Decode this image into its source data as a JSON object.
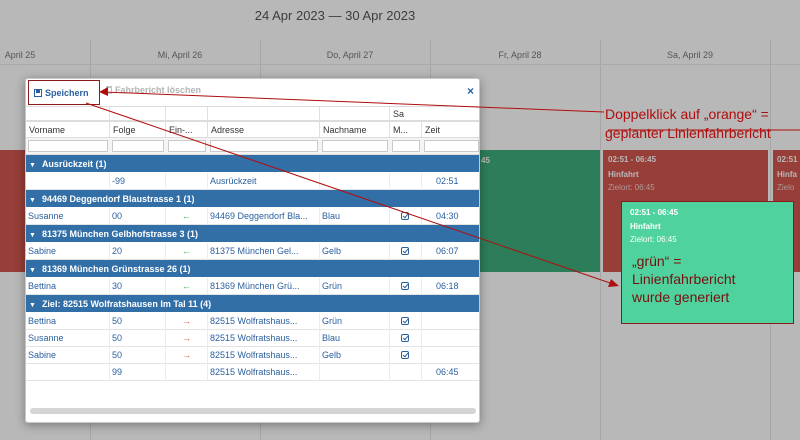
{
  "calendar": {
    "range": "24 Apr 2023 — 30 Apr 2023",
    "days": [
      "April 25",
      "Mi, April 26",
      "Do, April 27",
      "Fr, April 28",
      "Sa, April 29"
    ],
    "event_left": {
      "time": "02:51 - 06:45",
      "title": "Hinfahrt",
      "dest": "Zielort: 06:45"
    },
    "event_right": {
      "time": "02:51",
      "title": "Hinfa",
      "dest": "Zielo"
    },
    "event_green_time": "45",
    "colors": {
      "green": "#3fae7e",
      "orange": "#d0574d",
      "new_green": "#4fd29d"
    }
  },
  "dialog": {
    "save_label": "Speichern",
    "delete_label": "Fahrbericht löschen",
    "close_label": "×",
    "columns": [
      "Vorname",
      "Folge",
      "Ein-...",
      "Adresse",
      "Nachname",
      "M...",
      "Zeit"
    ],
    "column_group": "Sa",
    "groups": [
      {
        "title": "Ausrückzeit (1)",
        "rows": [
          {
            "vorname": "",
            "folge": "-99",
            "dir": "",
            "adresse": "Ausrückzeit",
            "nachname": "",
            "check": false,
            "zeit": "02:51"
          }
        ]
      },
      {
        "title": "94469 Deggendorf Blaustrasse 1 (1)",
        "rows": [
          {
            "vorname": "Susanne",
            "folge": "00",
            "dir": "in",
            "adresse": "94469 Deggendorf Bla...",
            "nachname": "Blau",
            "check": true,
            "zeit": "04:30"
          }
        ]
      },
      {
        "title": "81375 München Gelbhofstrasse 3 (1)",
        "rows": [
          {
            "vorname": "Sabine",
            "folge": "20",
            "dir": "in",
            "adresse": "81375 München Gel...",
            "nachname": "Gelb",
            "check": true,
            "zeit": "06:07"
          }
        ]
      },
      {
        "title": "81369 München Grünstrasse 26 (1)",
        "rows": [
          {
            "vorname": "Bettina",
            "folge": "30",
            "dir": "in",
            "adresse": "81369 München Grü...",
            "nachname": "Grün",
            "check": true,
            "zeit": "06:18"
          }
        ]
      },
      {
        "title": "Ziel: 82515 Wolfratshausen Im Tal 11 (4)",
        "rows": [
          {
            "vorname": "Bettina",
            "folge": "50",
            "dir": "out",
            "adresse": "82515 Wolfratshaus...",
            "nachname": "Grün",
            "check": true,
            "zeit": ""
          },
          {
            "vorname": "Susanne",
            "folge": "50",
            "dir": "out",
            "adresse": "82515 Wolfratshaus...",
            "nachname": "Blau",
            "check": true,
            "zeit": ""
          },
          {
            "vorname": "Sabine",
            "folge": "50",
            "dir": "out",
            "adresse": "82515 Wolfratshaus...",
            "nachname": "Gelb",
            "check": true,
            "zeit": ""
          },
          {
            "vorname": "",
            "folge": "99",
            "dir": "",
            "adresse": "82515 Wolfratshaus...",
            "nachname": "",
            "check": false,
            "zeit": "06:45"
          }
        ]
      }
    ]
  },
  "annotation": {
    "line1": "Doppelklick auf „orange“ =",
    "line2": "geplanter Linienfahrbericht"
  },
  "green_note": {
    "time": "02:51 - 06:45",
    "title": "Hinfahrt",
    "dest": "Zielort: 06:45",
    "line1": "„grün“ =",
    "line2": "Linienfahrbericht",
    "line3": "wurde generiert"
  }
}
